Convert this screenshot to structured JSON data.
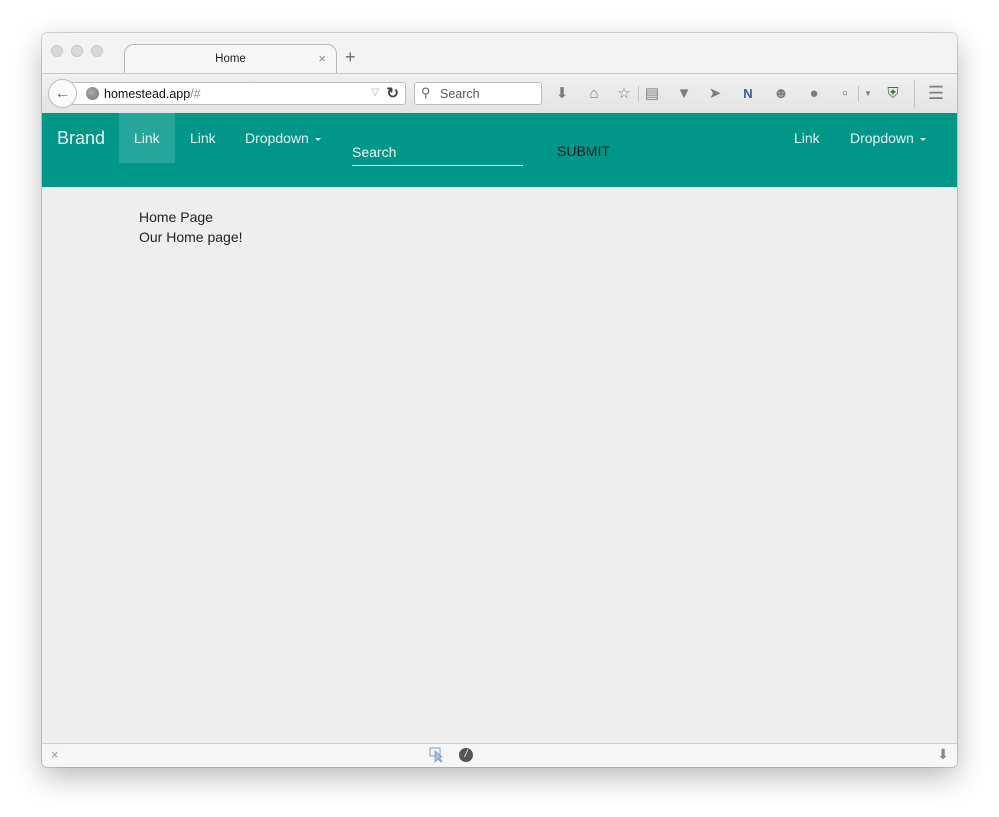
{
  "browser": {
    "tab": {
      "title": "Home",
      "close_glyph": "×"
    },
    "new_tab_glyph": "+",
    "url": {
      "host": "homestead.app",
      "rest": "/#"
    },
    "search": {
      "placeholder": "Search"
    },
    "toolbar_icons": [
      "download-icon",
      "home-icon",
      "bookmark-star-icon",
      "reading-list-icon",
      "pocket-icon",
      "send-icon",
      "onenote-clipper-icon",
      "chat-icon",
      "extension-bubbles-icon",
      "clipboard-icon",
      "dropdown-arrow-icon",
      "wot-shield-icon",
      "menu-icon"
    ]
  },
  "navbar": {
    "brand": "Brand",
    "left_items": [
      {
        "label": "Link",
        "active": true
      },
      {
        "label": "Link",
        "active": false
      },
      {
        "label": "Dropdown",
        "dropdown": true
      }
    ],
    "search_placeholder": "Search",
    "submit_label": "SUBMIT",
    "right_items": [
      {
        "label": "Link"
      },
      {
        "label": "Dropdown",
        "dropdown": true
      }
    ],
    "color": "#009688",
    "active_color": "#26a69a"
  },
  "content": {
    "title": "Home Page",
    "subtitle": "Our Home page!"
  },
  "statusbar": {
    "close_glyph": "×"
  }
}
